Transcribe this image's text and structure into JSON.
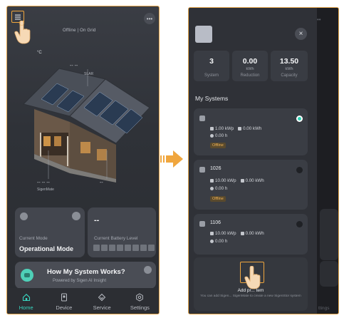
{
  "left_screen": {
    "status": "Offline | On Grid",
    "temperature_unit": "°C",
    "house_labels": {
      "top": "-- --",
      "solar": "SLAR",
      "left_dash": "-- -- --",
      "left_name": "SigenMate",
      "right_dash": "--"
    },
    "mode_card": {
      "label": "Current Mode",
      "value": "Operational Mode"
    },
    "battery_card": {
      "value": "--",
      "label": "Current Battery Level"
    },
    "how_card": {
      "title": "How My System Works?",
      "subtitle": "Powered by Sigen AI Insight"
    },
    "nav": [
      {
        "label": "Home",
        "icon": "home-icon",
        "active": true
      },
      {
        "label": "Device",
        "icon": "device-icon",
        "active": false
      },
      {
        "label": "Service",
        "icon": "service-icon",
        "active": false
      },
      {
        "label": "Settings",
        "icon": "settings-icon",
        "active": false
      }
    ]
  },
  "right_screen": {
    "close_label": "×",
    "stats": [
      {
        "value": "3",
        "unit": "",
        "label": "System"
      },
      {
        "value": "0.00",
        "unit": "kWh",
        "label": "Reduction"
      },
      {
        "value": "13.50",
        "unit": "kWh",
        "label": "Capacity"
      }
    ],
    "section_title": "My Systems",
    "systems": [
      {
        "name": "",
        "power": "1.00 kWp",
        "energy": "0.00 kWh",
        "hours": "0.00 h",
        "badge": "Offline",
        "selected": true
      },
      {
        "name": "1026",
        "power": "10.00 kWp",
        "energy": "0.00 kWh",
        "hours": "0.00 h",
        "badge": "Offline",
        "selected": false
      },
      {
        "name": "1106",
        "power": "10.00 kWp",
        "energy": "0.00 kWh",
        "hours": "0.00 h",
        "badge": "",
        "selected": false
      }
    ],
    "add_card": {
      "title": "Add pr... tem",
      "subtitle": "You can add Sigen... SigenMate to create a new SigenStor system"
    },
    "shadow_nav_label": "ttings"
  },
  "colors": {
    "accent": "#38d6c0",
    "highlight": "#f0a63e",
    "offline_badge": "#f0b357"
  }
}
